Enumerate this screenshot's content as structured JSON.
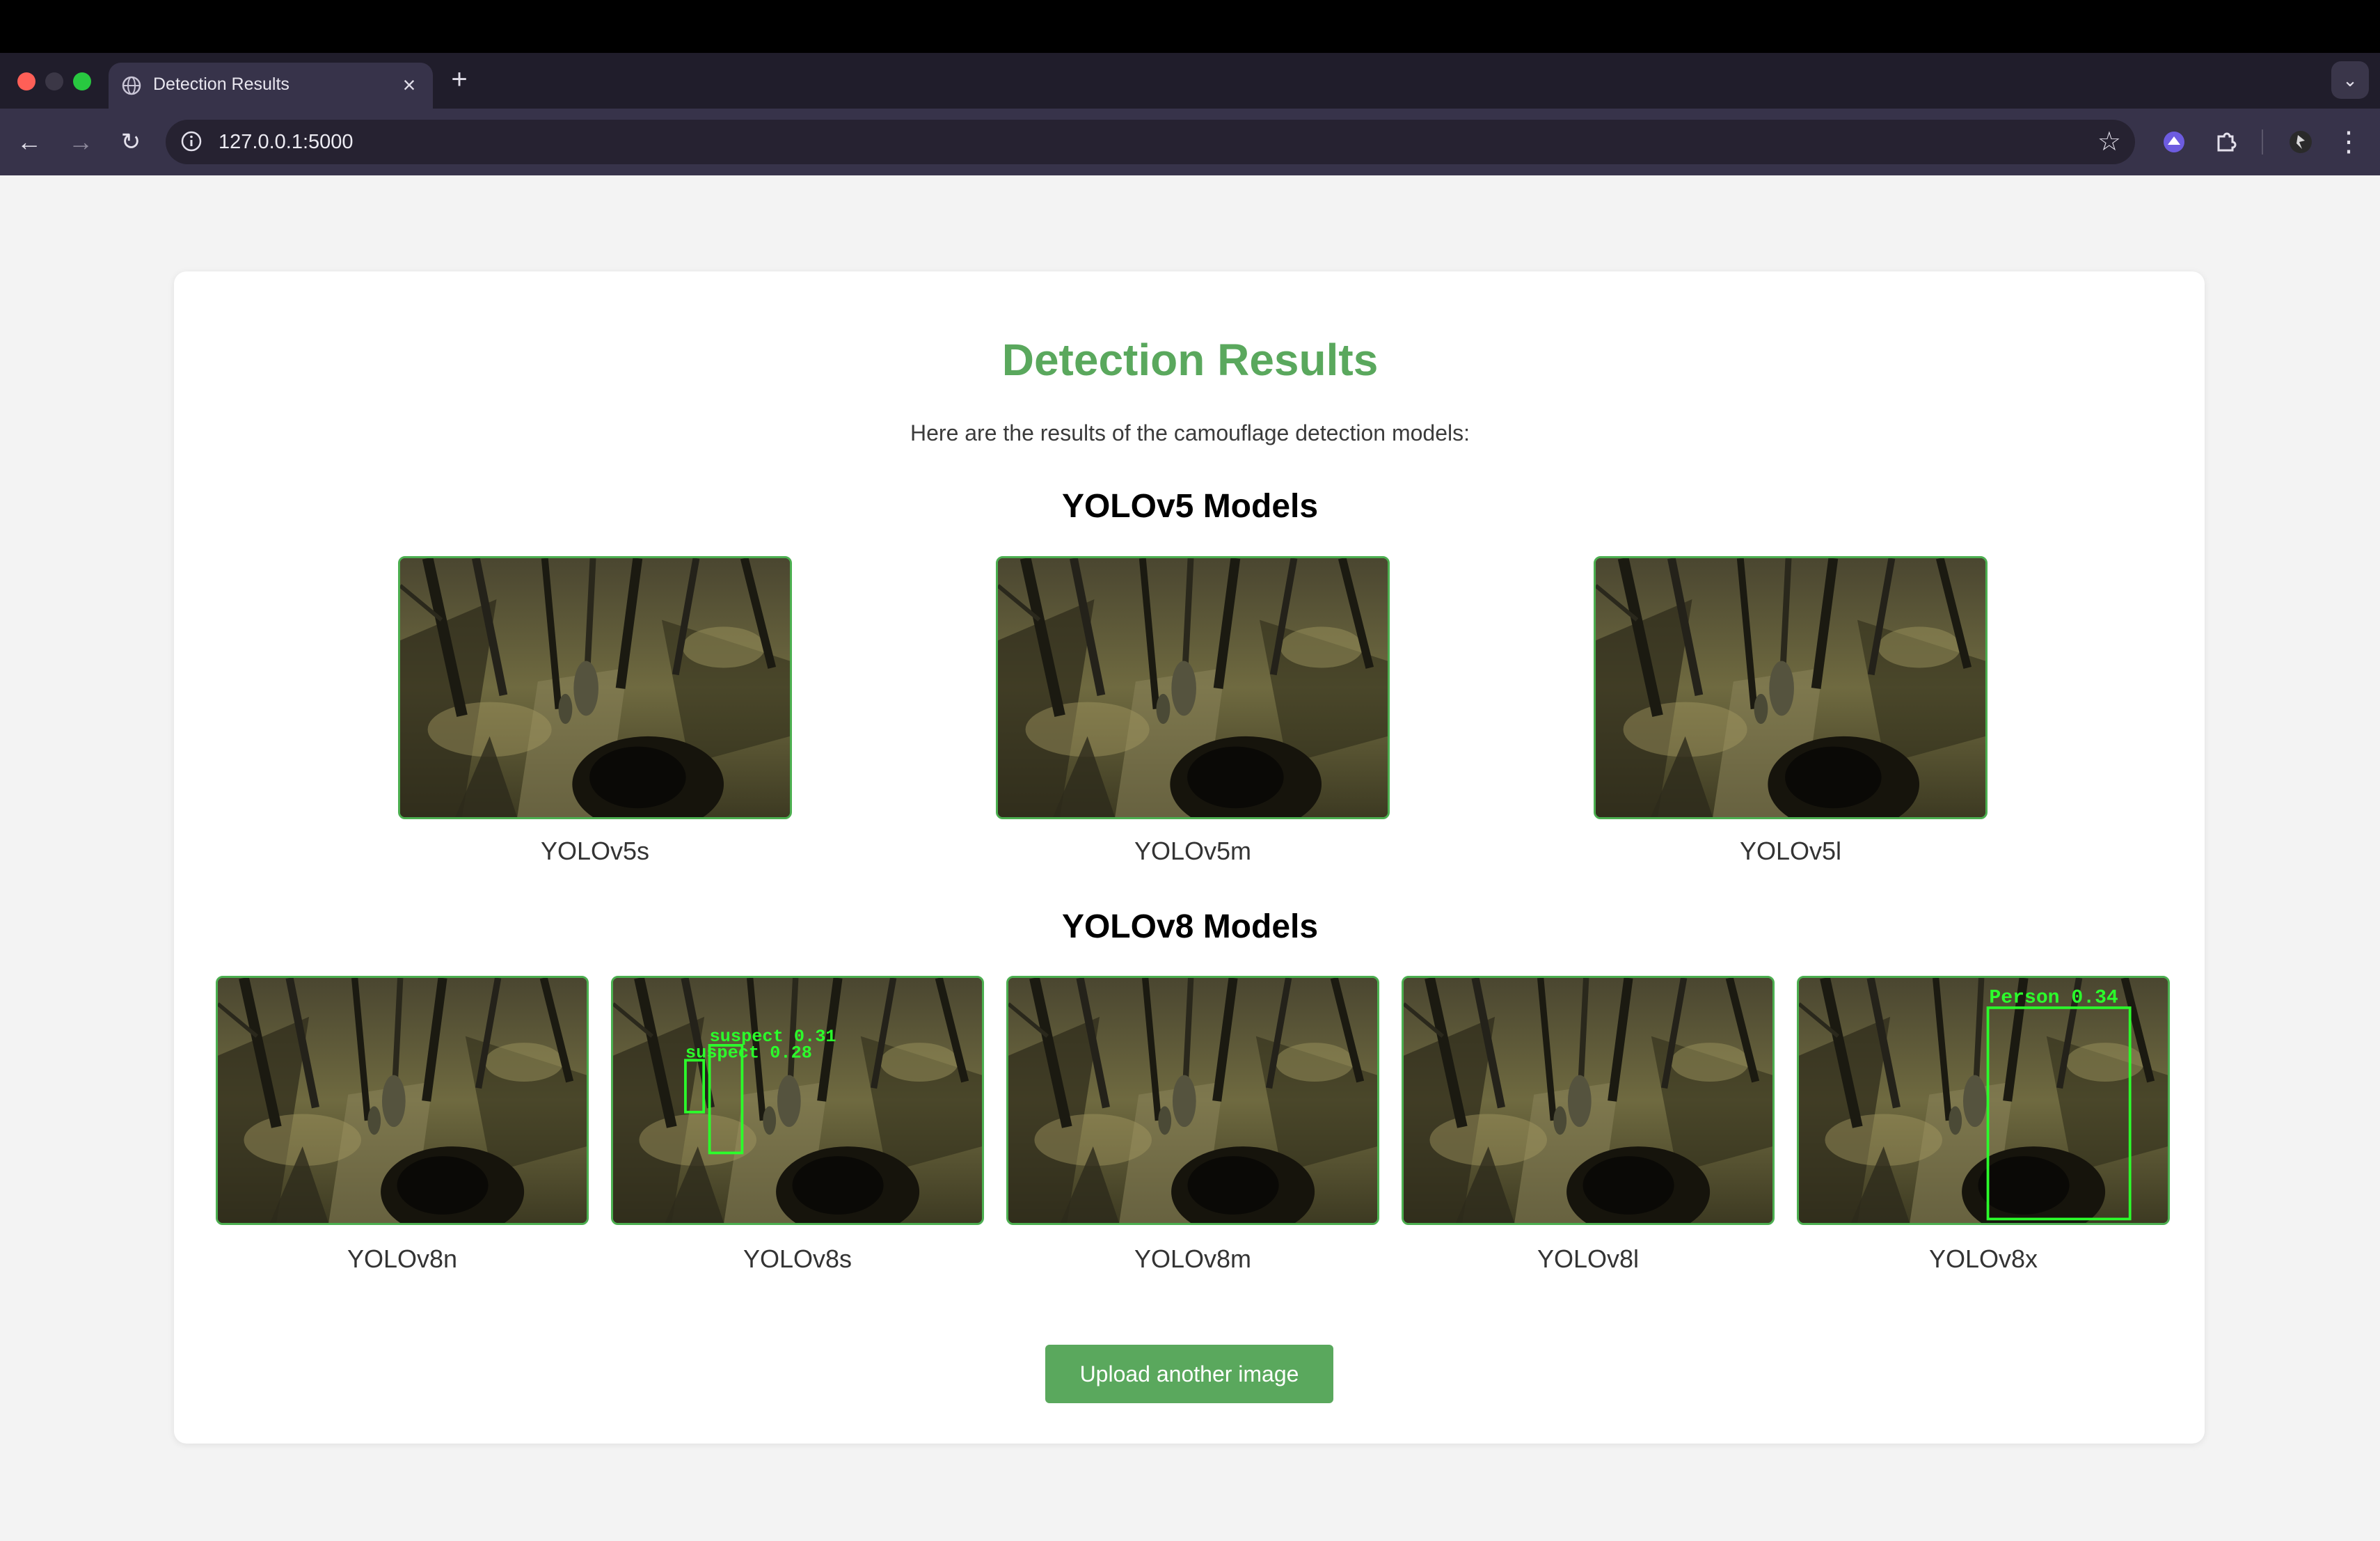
{
  "browser": {
    "tab_title": "Detection Results",
    "url": "127.0.0.1:5000"
  },
  "page": {
    "title": "Detection Results",
    "subtitle": "Here are the results of the camouflage detection models:",
    "colors": {
      "accent": "#5aa85d",
      "image_border": "#4caf50",
      "detection_box": "#2bff2b"
    }
  },
  "yolov5": {
    "heading": "YOLOv5 Models",
    "models": [
      {
        "label": "YOLOv5s",
        "detections": []
      },
      {
        "label": "YOLOv5m",
        "detections": []
      },
      {
        "label": "YOLOv5l",
        "detections": []
      }
    ]
  },
  "yolov8": {
    "heading": "YOLOv8 Models",
    "models": [
      {
        "label": "YOLOv8n",
        "detections": []
      },
      {
        "label": "YOLOv8s",
        "detections": [
          {
            "text": "suspect 0.31"
          },
          {
            "text": "suspect 0.28"
          }
        ]
      },
      {
        "label": "YOLOv8m",
        "detections": []
      },
      {
        "label": "YOLOv8l",
        "detections": []
      },
      {
        "label": "YOLOv8x",
        "detections": [
          {
            "text": "Person 0.34"
          }
        ]
      }
    ]
  },
  "upload_button": "Upload another image"
}
